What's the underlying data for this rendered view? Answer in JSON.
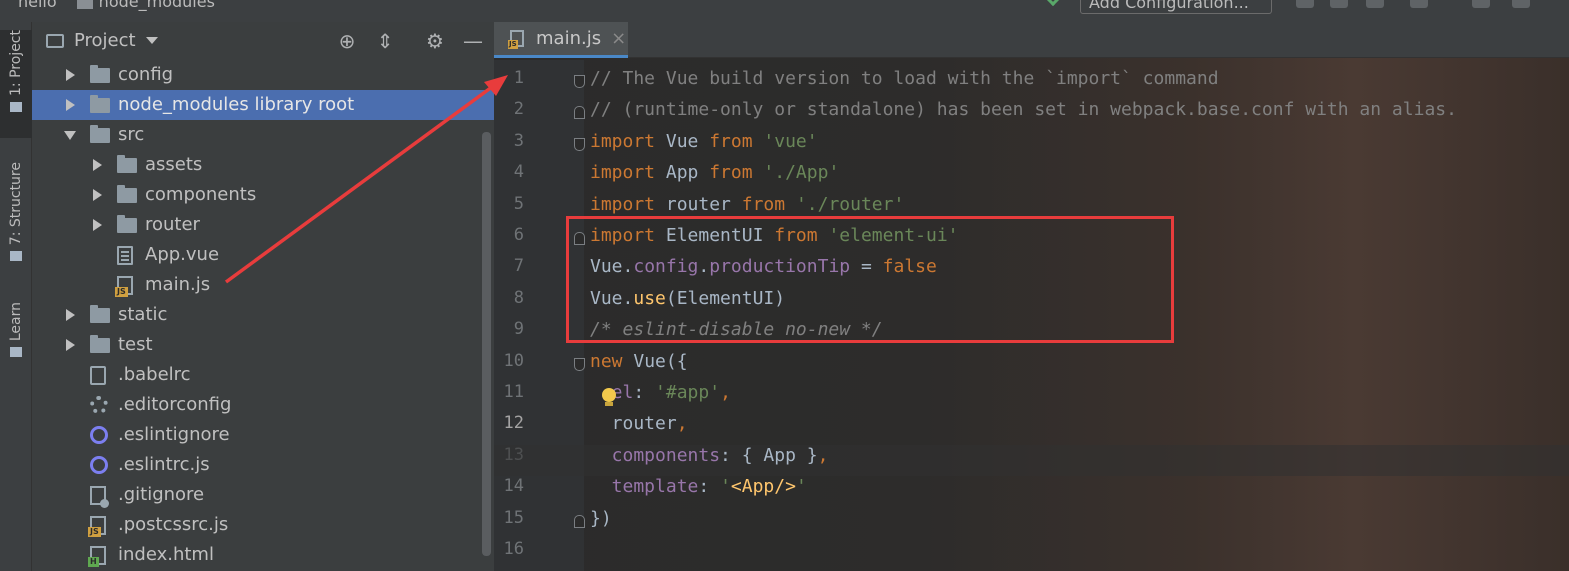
{
  "topbar": {
    "breadcrumb_project": "hello",
    "breadcrumb_folder": "node_modules",
    "run_config_label": "Add Configuration..."
  },
  "tool_strip": {
    "project_tab": "1: Project",
    "structure_tab": "7: Structure",
    "learn_tab": "Learn"
  },
  "project_panel": {
    "title": "Project",
    "header_buttons": [
      "locate-icon",
      "collapse-icon",
      "gear-icon",
      "minimize-icon"
    ],
    "tree": [
      {
        "label": "config",
        "type": "folder",
        "expand": "collapsed",
        "depth": 0
      },
      {
        "label": "node_modules  library root",
        "type": "folder",
        "expand": "collapsed",
        "depth": 0,
        "selected": true
      },
      {
        "label": "src",
        "type": "folder",
        "expand": "expanded",
        "depth": 0
      },
      {
        "label": "assets",
        "type": "folder",
        "expand": "collapsed",
        "depth": 1
      },
      {
        "label": "components",
        "type": "folder",
        "expand": "collapsed",
        "depth": 1
      },
      {
        "label": "router",
        "type": "folder",
        "expand": "collapsed",
        "depth": 1
      },
      {
        "label": "App.vue",
        "type": "vue",
        "depth": 1
      },
      {
        "label": "main.js",
        "type": "js",
        "depth": 1
      },
      {
        "label": "static",
        "type": "folder",
        "expand": "collapsed",
        "depth": 0
      },
      {
        "label": "test",
        "type": "folder",
        "expand": "collapsed",
        "depth": 0
      },
      {
        "label": ".babelrc",
        "type": "babel",
        "depth": 0
      },
      {
        "label": ".editorconfig",
        "type": "gear",
        "depth": 0
      },
      {
        "label": ".eslintignore",
        "type": "eslint",
        "depth": 0
      },
      {
        "label": ".eslintrc.js",
        "type": "eslint",
        "depth": 0
      },
      {
        "label": ".gitignore",
        "type": "git",
        "depth": 0
      },
      {
        "label": ".postcssrc.js",
        "type": "js",
        "depth": 0
      },
      {
        "label": "index.html",
        "type": "html",
        "depth": 0
      }
    ]
  },
  "editor": {
    "tab_label": "main.js",
    "tab_close": "×",
    "current_line": 12,
    "line_numbers": [
      "1",
      "2",
      "3",
      "4",
      "5",
      "6",
      "7",
      "8",
      "9",
      "10",
      "11",
      "12",
      "13",
      "14",
      "15",
      "16"
    ],
    "lines": [
      [
        {
          "t": "// The Vue build version to load with the `import` command",
          "c": "cm"
        }
      ],
      [
        {
          "t": "// (runtime-only or standalone) has been set in webpack.base.conf with an alias.",
          "c": "cm"
        }
      ],
      [
        {
          "t": "import",
          "c": "kw"
        },
        {
          "t": " Vue ",
          "c": "plain"
        },
        {
          "t": "from",
          "c": "kw"
        },
        {
          "t": " ",
          "c": "plain"
        },
        {
          "t": "'vue'",
          "c": "str"
        }
      ],
      [
        {
          "t": "import",
          "c": "kw"
        },
        {
          "t": " App ",
          "c": "plain"
        },
        {
          "t": "from",
          "c": "kw"
        },
        {
          "t": " ",
          "c": "plain"
        },
        {
          "t": "'./App'",
          "c": "str"
        }
      ],
      [
        {
          "t": "import",
          "c": "kw"
        },
        {
          "t": " router ",
          "c": "plain"
        },
        {
          "t": "from",
          "c": "kw"
        },
        {
          "t": " ",
          "c": "plain"
        },
        {
          "t": "'./router'",
          "c": "str"
        }
      ],
      [
        {
          "t": "import",
          "c": "kw"
        },
        {
          "t": " ElementUI ",
          "c": "plain"
        },
        {
          "t": "from",
          "c": "kw"
        },
        {
          "t": " ",
          "c": "plain"
        },
        {
          "t": "'element-ui'",
          "c": "str"
        }
      ],
      [
        {
          "t": "Vue.",
          "c": "plain"
        },
        {
          "t": "config",
          "c": "prop"
        },
        {
          "t": ".",
          "c": "plain"
        },
        {
          "t": "productionTip",
          "c": "prop"
        },
        {
          "t": " = ",
          "c": "plain"
        },
        {
          "t": "false",
          "c": "kw"
        }
      ],
      [
        {
          "t": "Vue.",
          "c": "plain"
        },
        {
          "t": "use",
          "c": "fn"
        },
        {
          "t": "(ElementUI)",
          "c": "plain"
        }
      ],
      [
        {
          "t": "/* eslint-disable no-new */",
          "c": "cm-i"
        }
      ],
      [
        {
          "t": "new",
          "c": "kw"
        },
        {
          "t": " Vue({",
          "c": "plain"
        }
      ],
      [
        {
          "t": "  el",
          "c": "prop"
        },
        {
          "t": ": ",
          "c": "plain"
        },
        {
          "t": "'#app'",
          "c": "str"
        },
        {
          "t": ",",
          "c": "kw"
        }
      ],
      [
        {
          "t": "  router",
          "c": "plain"
        },
        {
          "t": ",",
          "c": "kw"
        }
      ],
      [
        {
          "t": "  components",
          "c": "prop"
        },
        {
          "t": ": { App }",
          "c": "plain"
        },
        {
          "t": ",",
          "c": "kw"
        }
      ],
      [
        {
          "t": "  template",
          "c": "prop"
        },
        {
          "t": ": ",
          "c": "plain"
        },
        {
          "t": "'",
          "c": "str"
        },
        {
          "t": "<App/>",
          "c": "fn"
        },
        {
          "t": "'",
          "c": "str"
        }
      ],
      [
        {
          "t": "})",
          "c": "plain"
        }
      ],
      []
    ]
  },
  "colors": {
    "selection": "#4b6eaf",
    "keyword": "#cc7832",
    "string": "#6a8759",
    "comment": "#808080",
    "property": "#9876aa",
    "function": "#ffc66d",
    "annotation": "#e83c3c"
  }
}
